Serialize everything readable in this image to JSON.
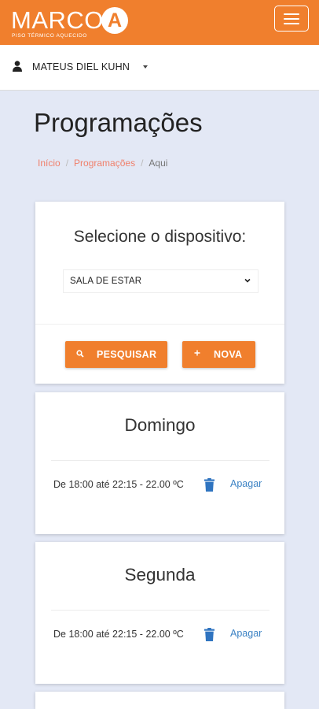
{
  "header": {
    "logo_word": "MARCO",
    "logo_badge_letter": "A",
    "logo_subtitle": "PISO TÉRMICO AQUECIDO",
    "menu_icon": "hamburger-icon",
    "brand_color": "#f07f2d"
  },
  "user": {
    "icon": "user-icon",
    "name": "MATEUS DIEL KUHN",
    "caret_icon": "caret-down-icon"
  },
  "page": {
    "title": "Programações",
    "breadcrumb": [
      "Início",
      "Programações",
      "Aqui"
    ]
  },
  "device_panel": {
    "title": "Selecione o dispositivo:",
    "selected_device": "SALA DE ESTAR",
    "search_button": {
      "icon": "search-icon",
      "label": "PESQUISAR"
    },
    "new_button": {
      "icon": "plus-icon",
      "label": "NOVA"
    }
  },
  "schedules": [
    {
      "day": "Domingo",
      "entries": [
        {
          "text": "De 18:00 até 22:15 - 22.00 ºC",
          "delete_icon": "trash-icon",
          "delete_label": "Apagar"
        }
      ]
    },
    {
      "day": "Segunda",
      "entries": [
        {
          "text": "De 18:00 até 22:15 - 22.00 ºC",
          "delete_icon": "trash-icon",
          "delete_label": "Apagar"
        }
      ]
    }
  ],
  "colors": {
    "accent": "#f07f2d",
    "background": "#e3e8f5",
    "link": "#3b82c4",
    "breadcrumb_link": "#f07f6a",
    "trash": "#2f74c0"
  }
}
